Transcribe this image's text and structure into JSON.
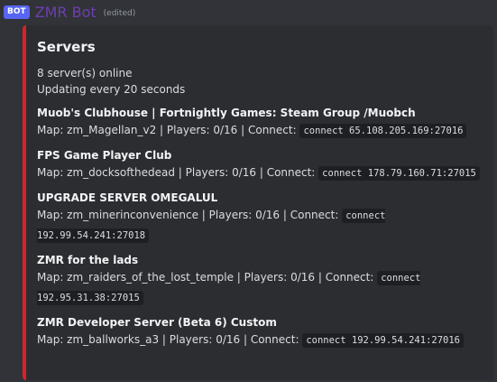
{
  "header": {
    "bot_tag": "BOT",
    "bot_name": "ZMR Bot",
    "edited_label": "(edited)"
  },
  "embed": {
    "accent_color": "#e01e26",
    "title": "Servers",
    "online_text": "8 server(s) online",
    "update_text": "Updating every 20 seconds",
    "servers": [
      {
        "name": "Muob's Clubhouse | Fortnightly Games: Steam Group /Muobch",
        "info": "Map: zm_Magellan_v2 | Players: 0/16 | Connect: ",
        "connect": "connect 65.108.205.169:27016"
      },
      {
        "name": "FPS Game Player Club",
        "info": "Map: zm_docksofthedead | Players: 0/16 | Connect: ",
        "connect": "connect 178.79.160.71:27015"
      },
      {
        "name": "UPGRADE SERVER OMEGALUL",
        "info": "Map: zm_minerinconvenience | Players: 0/16 | Connect: ",
        "connect": "connect 192.99.54.241:27018"
      },
      {
        "name": "ZMR for the lads",
        "info": "Map: zm_raiders_of_the_lost_temple | Players: 0/16 | Connect: ",
        "connect": "connect 192.95.31.38:27015"
      },
      {
        "name": "ZMR Developer Server (Beta 6) Custom",
        "info": "Map: zm_ballworks_a3 | Players: 0/16 | Connect: ",
        "connect": "connect 192.99.54.241:27016"
      }
    ]
  }
}
